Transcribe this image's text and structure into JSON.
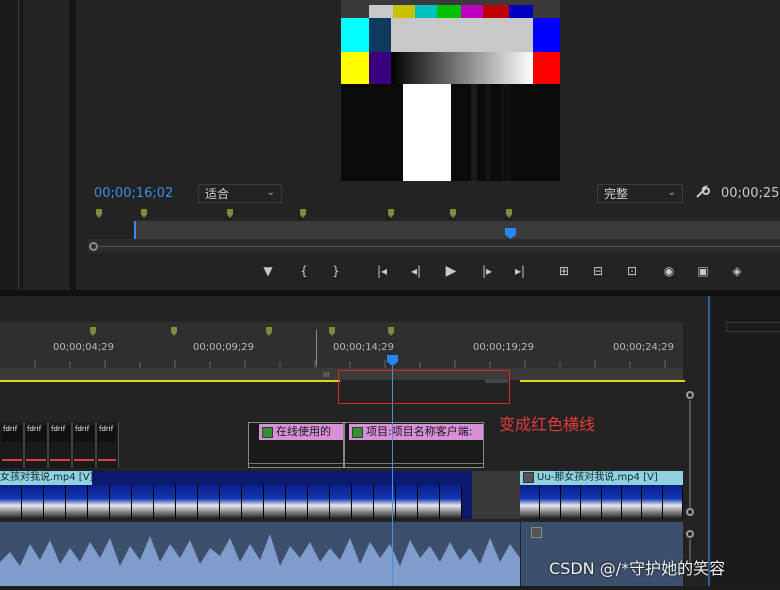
{
  "program_monitor": {
    "timecode_current": "00;00;16;02",
    "zoom_select": "适合",
    "resolution_select": "完整",
    "timecode_duration": "00;00;25;",
    "transport": {
      "add_marker": "▼",
      "mark_in": "{",
      "mark_out": "}",
      "go_to_in": "|◂",
      "step_back": "◂|",
      "play": "▶",
      "step_forward": "|▸",
      "go_to_out": "▸|",
      "lift": "⊞",
      "extract": "⊟",
      "compare": "⊡",
      "export_frame": "◉",
      "button_editor": "▣",
      "vr": "◈"
    }
  },
  "colors": {
    "accent_blue": "#3d8ee8",
    "marker_green": "#7e8b3b",
    "work_area_yellow": "#e3d31a",
    "title_clip_pink": "#d890d9",
    "video_clip_cyan": "#8fd1de",
    "audio_blue": "#3c4f6c",
    "annotation_red": "#e02a2a"
  },
  "timeline": {
    "ruler_labels": [
      "00;00;04;29",
      "00;00;09;29",
      "00;00;14;29",
      "00;00;19;29",
      "00;00;24;29"
    ],
    "work_area_handle": "III",
    "title_clips": {
      "clip1_label": "在线使用的",
      "clip2_label": "项目:项目名称客户端:"
    },
    "video_clips": {
      "left_label": "女孩对我说.mp4 [V]",
      "right_label": "Uu-那女孩对我说.mp4 [V]"
    },
    "graphic_clip_text": "fdrif"
  },
  "annotation": {
    "text": "变成红色横线"
  },
  "watermark": "CSDN @/*守护她的笑容"
}
